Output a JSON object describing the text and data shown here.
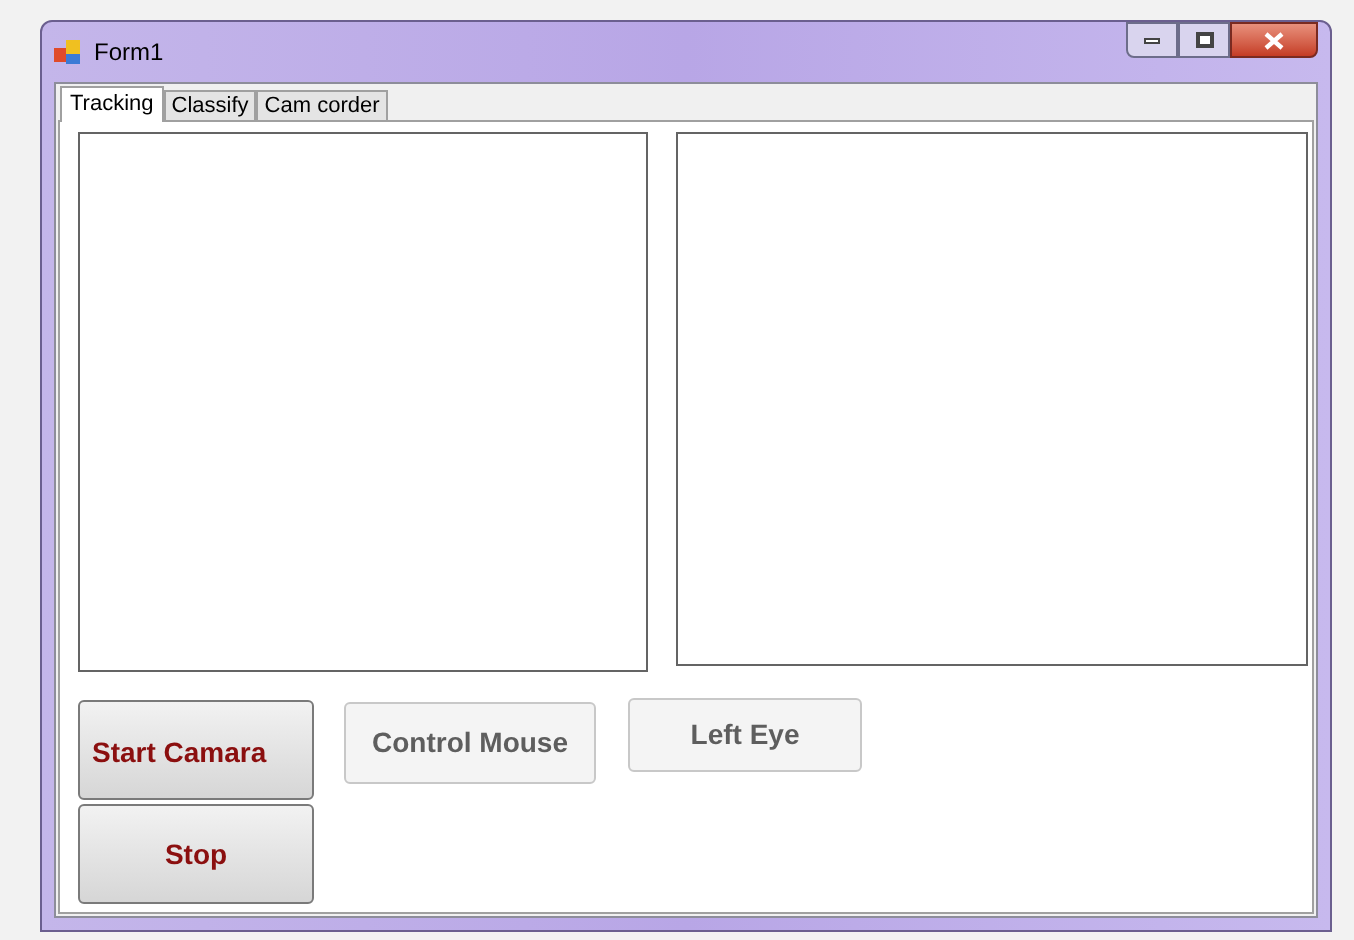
{
  "window": {
    "title": "Form1"
  },
  "tabs": [
    {
      "label": "Tracking",
      "selected": true
    },
    {
      "label": "Classify",
      "selected": false
    },
    {
      "label": "Cam corder",
      "selected": false
    }
  ],
  "buttons": [
    {
      "label": "Start Camara",
      "disabled": false
    },
    {
      "label": "Control Mouse",
      "disabled": true
    },
    {
      "label": "Left Eye",
      "disabled": true
    },
    {
      "label": "Stop",
      "disabled": false
    }
  ]
}
